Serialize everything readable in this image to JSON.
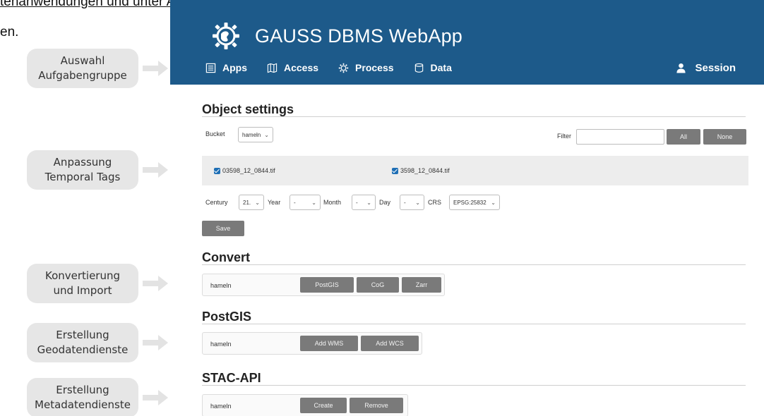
{
  "document": {
    "line1": "tenanwendungen und unter Access Anleitungen zur Nutzung der bereitgestellten Schnittstellen",
    "line2": "en."
  },
  "side_labels": [
    {
      "line1": "Auswahl",
      "line2": "Aufgabengruppe"
    },
    {
      "line1": "Anpassung",
      "line2": "Temporal Tags"
    },
    {
      "line1": "Konvertierung",
      "line2": "und Import"
    },
    {
      "line1": "Erstellung",
      "line2": "Geodatendienste"
    },
    {
      "line1": "Erstellung",
      "line2": "Metadatendienste"
    }
  ],
  "header": {
    "title": "GAUSS DBMS WebApp",
    "logo_icon": "gear-globe-logo-icon",
    "background": "#1d5a8a",
    "nav": [
      {
        "label": "Apps",
        "icon": "apps-icon"
      },
      {
        "label": "Access",
        "icon": "map-icon"
      },
      {
        "label": "Process",
        "icon": "gear-icon"
      },
      {
        "label": "Data",
        "icon": "database-icon"
      }
    ],
    "session": {
      "label": "Session",
      "icon": "user-icon"
    }
  },
  "object_settings": {
    "title": "Object settings",
    "bucket_label": "Bucket",
    "bucket_value": "hameln",
    "filter_label": "Filter",
    "filter_value": "",
    "all_label": "All",
    "none_label": "None",
    "files": [
      {
        "name": "03598_12_0844.tif",
        "checked": true
      },
      {
        "name": "3598_12_0844.tif",
        "checked": true
      }
    ],
    "century_label": "Century",
    "century_value": "21.",
    "year_label": "Year",
    "year_value": "-",
    "month_label": "Month",
    "month_value": "-",
    "day_label": "Day",
    "day_value": "-",
    "crs_label": "CRS",
    "crs_value": "EPSG:25832",
    "save_label": "Save"
  },
  "convert": {
    "title": "Convert",
    "row_name": "hameln",
    "buttons": [
      "PostGIS",
      "CoG",
      "Zarr"
    ]
  },
  "postgis": {
    "title": "PostGIS",
    "row_name": "hameln",
    "buttons": [
      "Add WMS",
      "Add WCS"
    ]
  },
  "stac_api": {
    "title": "STAC-API",
    "row_name": "hameln",
    "buttons": [
      "Create",
      "Remove"
    ]
  }
}
